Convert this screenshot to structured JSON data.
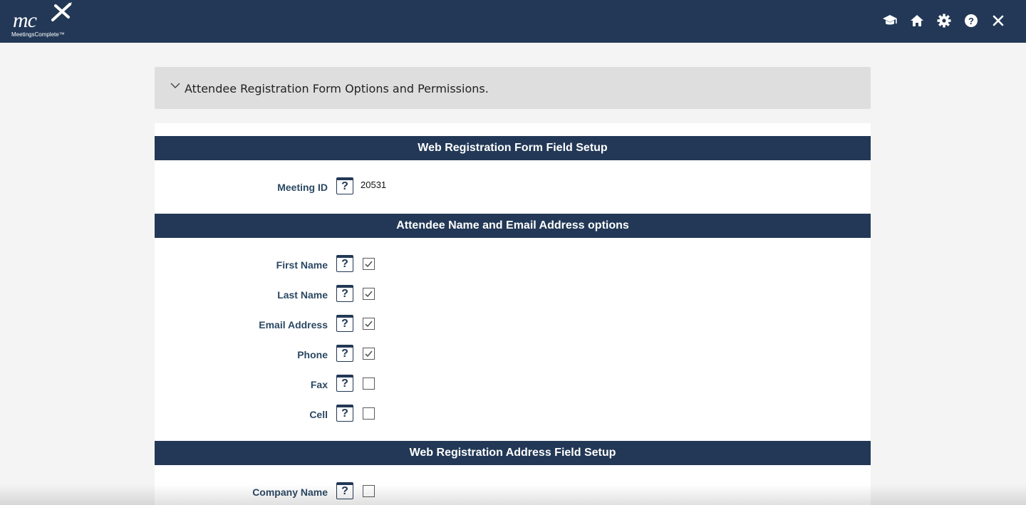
{
  "app": {
    "logo_mark": "mc",
    "logo_text": "MeetingsComplete™",
    "nav_icons": [
      "graduation-cap-icon",
      "home-icon",
      "gear-icon",
      "help-icon",
      "close-icon"
    ]
  },
  "panel": {
    "title": "Attendee Registration Form Options and Permissions."
  },
  "sections": {
    "form_setup": {
      "title": "Web Registration Form Field Setup"
    },
    "name_email": {
      "title": "Attendee Name and Email Address options"
    },
    "address": {
      "title": "Web Registration Address Field Setup"
    }
  },
  "meeting": {
    "label": "Meeting ID",
    "value": "20531"
  },
  "fields": {
    "first_name": {
      "label": "First Name",
      "checked": true
    },
    "last_name": {
      "label": "Last Name",
      "checked": true
    },
    "email": {
      "label": "Email Address",
      "checked": true
    },
    "phone": {
      "label": "Phone",
      "checked": true
    },
    "fax": {
      "label": "Fax",
      "checked": false
    },
    "cell": {
      "label": "Cell",
      "checked": false
    },
    "company": {
      "label": "Company Name",
      "checked": false
    }
  },
  "help_glyph": "?",
  "colors": {
    "navy": "#223856",
    "label": "#2b4863",
    "panel": "#dedede",
    "background": "#f4f4f4"
  }
}
